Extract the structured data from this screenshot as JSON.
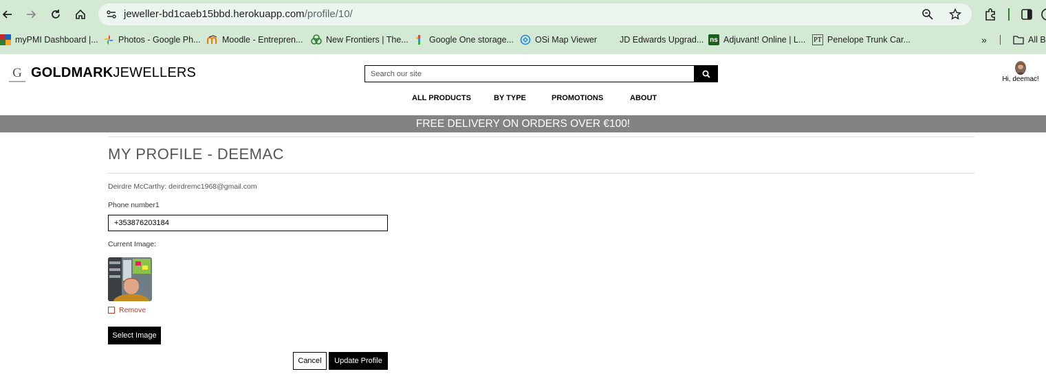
{
  "browser": {
    "url_host": "jeweller-bd1caeb15bbd.herokuapp.com",
    "url_path": "/profile/10/",
    "bookmarks": [
      {
        "label": "myPMI Dashboard |...",
        "icon": "pmi-icon"
      },
      {
        "label": "Photos - Google Ph...",
        "icon": "google-photos-icon"
      },
      {
        "label": "Moodle - Entrepren...",
        "icon": "moodle-icon"
      },
      {
        "label": "New Frontiers | The...",
        "icon": "new-frontiers-icon"
      },
      {
        "label": "Google One storage...",
        "icon": "google-one-icon"
      },
      {
        "label": "OSi Map Viewer",
        "icon": "osi-icon"
      },
      {
        "label": "JD Edwards Upgrad...",
        "icon": ""
      },
      {
        "label": "Adjuvant! Online | L...",
        "icon": "ns-icon"
      },
      {
        "label": "Penelope Trunk Car...",
        "icon": "pt-icon"
      }
    ],
    "bookmarks_overflow": "»",
    "all_bookmarks": "All B"
  },
  "header": {
    "logo_bold": "GOLDMARK",
    "logo_rest": "JEWELLERS",
    "logo_mark_letter": "G",
    "search_placeholder": "Search our site",
    "greeting": "Hi, deemac!"
  },
  "nav": [
    "ALL PRODUCTS",
    "BY TYPE",
    "PROMOTIONS",
    "ABOUT"
  ],
  "promo_banner": "FREE DELIVERY ON ORDERS OVER €100!",
  "profile": {
    "title": "MY PROFILE - DEEMAC",
    "user_line": "Deirdre McCarthy: deirdremc1968@gmail.com",
    "phone_label": "Phone number1",
    "phone_value": "+353876203184",
    "current_image_label": "Current Image:",
    "remove_label": "Remove",
    "select_image_label": "Select Image",
    "cancel_label": "Cancel",
    "update_label": "Update Profile"
  },
  "colors": {
    "chrome_bg": "#d3e9d4",
    "promo_bg": "#838383",
    "remove_red": "#c0392b"
  }
}
